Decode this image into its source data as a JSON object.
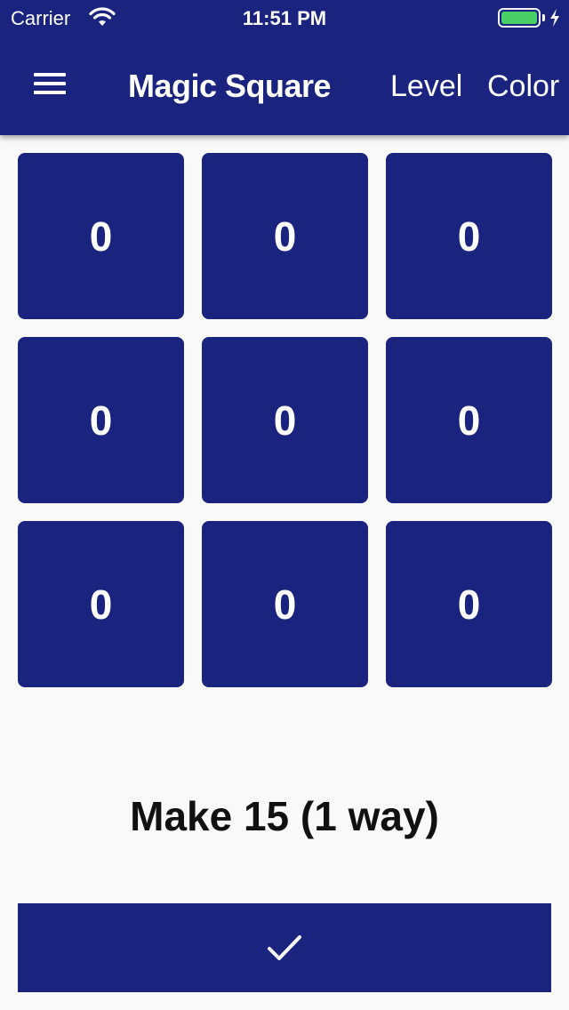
{
  "status_bar": {
    "carrier": "Carrier",
    "time": "11:51 PM",
    "battery_color": "#4cd964"
  },
  "app_bar": {
    "menu_icon": "hamburger-menu-icon",
    "title": "Magic Square",
    "actions": [
      "Level",
      "Color"
    ],
    "background": "#1a237e"
  },
  "grid": {
    "cells": [
      "0",
      "0",
      "0",
      "0",
      "0",
      "0",
      "0",
      "0",
      "0"
    ]
  },
  "instruction": "Make 15 (1 way)",
  "submit": {
    "icon": "checkmark-icon"
  }
}
